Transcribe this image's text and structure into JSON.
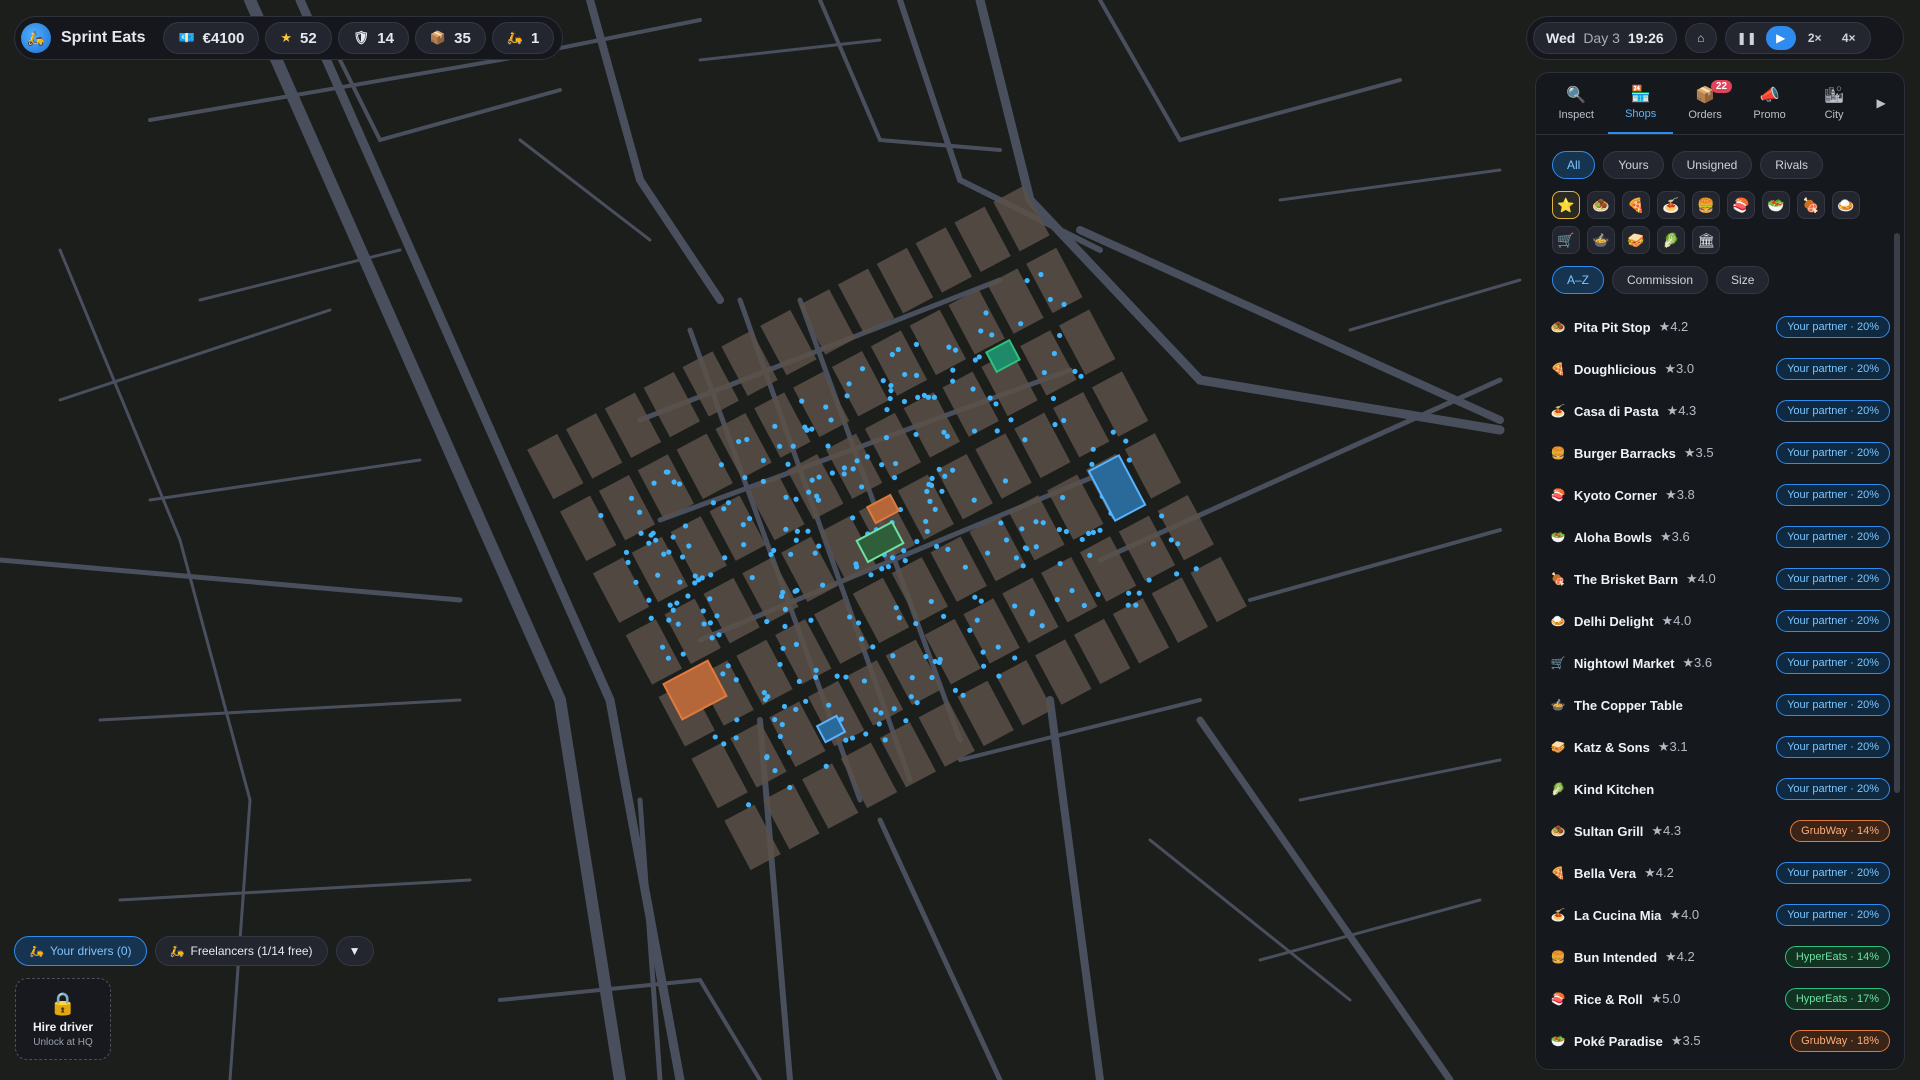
{
  "colors": {
    "accent": "#2e8cf0",
    "road": "#4a4f5e",
    "bg": "#1b1e1b",
    "block": "#5a5148",
    "marker": "#3fb6ff"
  },
  "hud": {
    "brand": "Sprint Eats",
    "stats": [
      {
        "icon": "cash-icon",
        "glyph": "💶",
        "value": "€4100"
      },
      {
        "icon": "star-icon",
        "glyph": "★",
        "value": "52"
      },
      {
        "icon": "shield-icon",
        "glyph": "🛡",
        "value": "14"
      },
      {
        "icon": "box-icon",
        "glyph": "📦",
        "value": "35"
      },
      {
        "icon": "scooter-icon",
        "glyph": "🛵",
        "value": "1"
      }
    ]
  },
  "time": {
    "weekday": "Wed",
    "day": "Day 3",
    "clock": "19:26",
    "home": "⌂",
    "pause": "❚❚",
    "play": "▶",
    "speed2": "2×",
    "speed4": "4×"
  },
  "panel": {
    "tabs": [
      {
        "label": "Inspect",
        "glyph": "🔍",
        "icon": "inspect-icon"
      },
      {
        "label": "Shops",
        "glyph": "🏪",
        "icon": "shop-icon"
      },
      {
        "label": "Orders",
        "glyph": "📦",
        "icon": "orders-icon",
        "badge": "22"
      },
      {
        "label": "Promo",
        "glyph": "📣",
        "icon": "promo-icon"
      },
      {
        "label": "City",
        "glyph": "🏙",
        "icon": "city-icon"
      }
    ],
    "more": "▶",
    "filters": [
      "All",
      "Yours",
      "Unsigned",
      "Rivals"
    ],
    "categories": [
      {
        "icon": "favorite-icon",
        "glyph": "⭐"
      },
      {
        "icon": "falafel-icon",
        "glyph": "🧆"
      },
      {
        "icon": "pizza-icon",
        "glyph": "🍕"
      },
      {
        "icon": "pasta-icon",
        "glyph": "🍝"
      },
      {
        "icon": "burger-icon",
        "glyph": "🍔"
      },
      {
        "icon": "sushi-icon",
        "glyph": "🍣"
      },
      {
        "icon": "bowl-icon",
        "glyph": "🥗"
      },
      {
        "icon": "bbq-icon",
        "glyph": "🍖"
      },
      {
        "icon": "curry-icon",
        "glyph": "🍛"
      },
      {
        "icon": "cart-icon",
        "glyph": "🛒"
      },
      {
        "icon": "pot-icon",
        "glyph": "🍲"
      },
      {
        "icon": "sandwich-icon",
        "glyph": "🥪"
      },
      {
        "icon": "leaf-icon",
        "glyph": "🥬"
      },
      {
        "icon": "building-icon",
        "glyph": "🏛"
      }
    ],
    "sorts": [
      "A–Z",
      "Commission",
      "Size"
    ],
    "shops": [
      {
        "glyph": "🧆",
        "name": "Pita Pit Stop",
        "rating": "★4.2",
        "tag": "Your partner · 20%",
        "kind": "partner"
      },
      {
        "glyph": "🍕",
        "name": "Doughlicious",
        "rating": "★3.0",
        "tag": "Your partner · 20%",
        "kind": "partner"
      },
      {
        "glyph": "🍝",
        "name": "Casa di Pasta",
        "rating": "★4.3",
        "tag": "Your partner · 20%",
        "kind": "partner"
      },
      {
        "glyph": "🍔",
        "name": "Burger Barracks",
        "rating": "★3.5",
        "tag": "Your partner · 20%",
        "kind": "partner"
      },
      {
        "glyph": "🍣",
        "name": "Kyoto Corner",
        "rating": "★3.8",
        "tag": "Your partner · 20%",
        "kind": "partner"
      },
      {
        "glyph": "🥗",
        "name": "Aloha Bowls",
        "rating": "★3.6",
        "tag": "Your partner · 20%",
        "kind": "partner"
      },
      {
        "glyph": "🍖",
        "name": "The Brisket Barn",
        "rating": "★4.0",
        "tag": "Your partner · 20%",
        "kind": "partner"
      },
      {
        "glyph": "🍛",
        "name": "Delhi Delight",
        "rating": "★4.0",
        "tag": "Your partner · 20%",
        "kind": "partner"
      },
      {
        "glyph": "🛒",
        "name": "Nightowl Market",
        "rating": "★3.6",
        "tag": "Your partner · 20%",
        "kind": "partner"
      },
      {
        "glyph": "🍲",
        "name": "The Copper Table",
        "rating": "",
        "tag": "Your partner · 20%",
        "kind": "partner"
      },
      {
        "glyph": "🥪",
        "name": "Katz & Sons",
        "rating": "★3.1",
        "tag": "Your partner · 20%",
        "kind": "partner"
      },
      {
        "glyph": "🥬",
        "name": "Kind Kitchen",
        "rating": "",
        "tag": "Your partner · 20%",
        "kind": "partner"
      },
      {
        "glyph": "🧆",
        "name": "Sultan Grill",
        "rating": "★4.3",
        "tag": "GrubWay · 14%",
        "kind": "grubway"
      },
      {
        "glyph": "🍕",
        "name": "Bella Vera",
        "rating": "★4.2",
        "tag": "Your partner · 20%",
        "kind": "partner"
      },
      {
        "glyph": "🍝",
        "name": "La Cucina Mia",
        "rating": "★4.0",
        "tag": "Your partner · 20%",
        "kind": "partner"
      },
      {
        "glyph": "🍔",
        "name": "Bun Intended",
        "rating": "★4.2",
        "tag": "HyperEats · 14%",
        "kind": "hypereats"
      },
      {
        "glyph": "🍣",
        "name": "Rice & Roll",
        "rating": "★5.0",
        "tag": "HyperEats · 17%",
        "kind": "hypereats"
      },
      {
        "glyph": "🥗",
        "name": "Poké Paradise",
        "rating": "★3.5",
        "tag": "GrubWay · 18%",
        "kind": "grubway"
      }
    ]
  },
  "drivers": {
    "yours": "Your drivers (0)",
    "freelancers": "Freelancers (1/14 free)",
    "expand": "▼"
  },
  "hire": {
    "title": "Hire driver",
    "subtitle": "Unlock at HQ"
  }
}
